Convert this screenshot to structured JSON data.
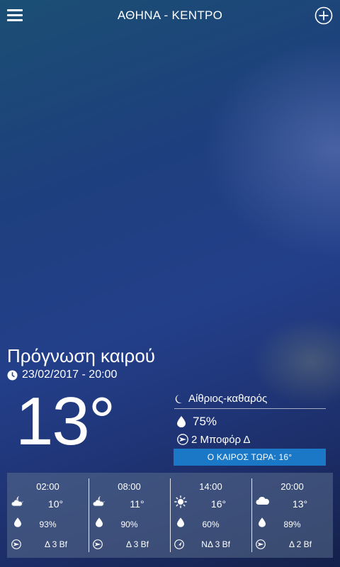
{
  "header": {
    "location": "ΑΘΗΝΑ - ΚΕΝΤΡΟ",
    "menu_icon": "hamburger-menu-icon",
    "add_icon": "plus-circle-icon"
  },
  "current": {
    "section_title": "Πρόγνωση καιρού",
    "datetime": "23/02/2017 - 20:00",
    "temperature": "13°",
    "condition": "Αίθριος-καθαρός",
    "condition_icon": "crescent-moon-icon",
    "humidity": "75%",
    "wind": "2 Μποφόρ Δ",
    "now_button": "Ο ΚΑΙΡΟΣ ΤΩΡΑ: 16°"
  },
  "hourly": [
    {
      "time": "02:00",
      "icon": "cloudy-night-icon",
      "temp": "10°",
      "humidity": "93%",
      "wind": "Δ 3 Bf"
    },
    {
      "time": "08:00",
      "icon": "cloudy-night-icon",
      "temp": "11°",
      "humidity": "90%",
      "wind": "Δ 3 Bf"
    },
    {
      "time": "14:00",
      "icon": "sun-icon",
      "temp": "16°",
      "humidity": "60%",
      "wind": "ΝΔ 3 Bf"
    },
    {
      "time": "20:00",
      "icon": "cloud-icon",
      "temp": "13°",
      "humidity": "89%",
      "wind": "Δ 2 Bf"
    }
  ],
  "colors": {
    "accent_button": "#1a78c7",
    "panel": "#5a6e8c"
  }
}
